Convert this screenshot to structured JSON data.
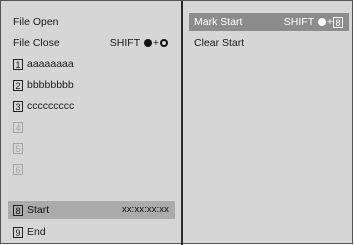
{
  "left_menu": {
    "file_open": "File Open",
    "file_close": {
      "label": "File Close",
      "shortcut": "SHIFT",
      "plus": "+"
    },
    "items": [
      {
        "num": "1",
        "label": "aaaaaaaa"
      },
      {
        "num": "2",
        "label": "bbbbbbbb"
      },
      {
        "num": "3",
        "label": "ccccccccc"
      },
      {
        "num": "4",
        "label": ""
      },
      {
        "num": "5",
        "label": ""
      },
      {
        "num": "6",
        "label": ""
      }
    ],
    "start": {
      "num": "8",
      "label": "Start",
      "timecode": "xx:xx:xx:xx"
    },
    "end": {
      "num": "9",
      "label": "End"
    }
  },
  "right_menu": {
    "mark_start": {
      "label": "Mark Start",
      "shortcut": "SHIFT",
      "plus": "+",
      "key": "8"
    },
    "clear_start": "Clear Start"
  },
  "colors": {
    "panel": "#d6d6d6",
    "selected_right": "#8c8c8c",
    "selected_left": "#ababab"
  }
}
